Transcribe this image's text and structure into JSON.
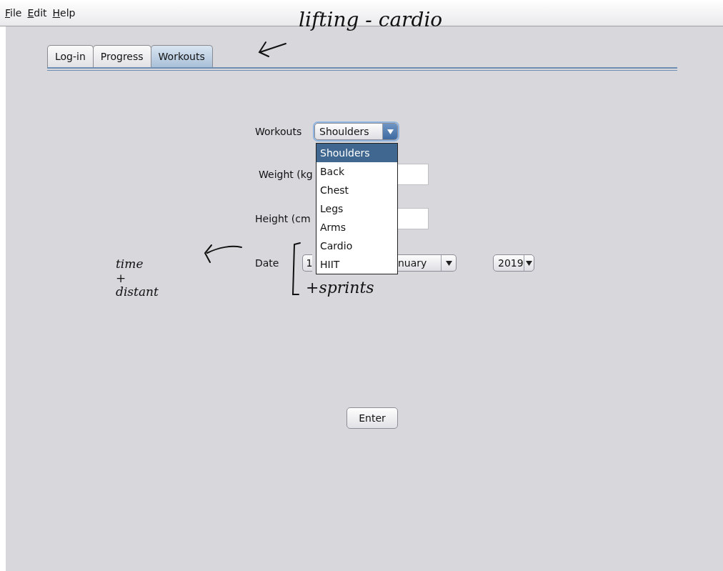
{
  "menu": [
    "File",
    "Edit",
    "Help"
  ],
  "tabs": [
    {
      "label": "Log-in",
      "selected": false
    },
    {
      "label": "Progress",
      "selected": false
    },
    {
      "label": "Workouts",
      "selected": true
    }
  ],
  "form": {
    "workouts_label": "Workouts",
    "workouts_value": "Shoulders",
    "weight_label": "Weight (kg",
    "height_label": "Height (cm",
    "date_label": "Date",
    "day_value": "1",
    "month_value": "nuary",
    "year_value": "2019"
  },
  "dropdown": [
    {
      "label": "Shoulders",
      "selected": true
    },
    {
      "label": "Back",
      "selected": false
    },
    {
      "label": "Chest",
      "selected": false
    },
    {
      "label": "Legs",
      "selected": false
    },
    {
      "label": "Arms",
      "selected": false
    },
    {
      "label": "Cardio",
      "selected": false
    },
    {
      "label": "HIIT",
      "selected": false
    }
  ],
  "enter_button": "Enter",
  "annotations": {
    "top": "lifting - cardio",
    "left": [
      "time",
      "+",
      "distant"
    ],
    "bracket": "+sprints"
  }
}
